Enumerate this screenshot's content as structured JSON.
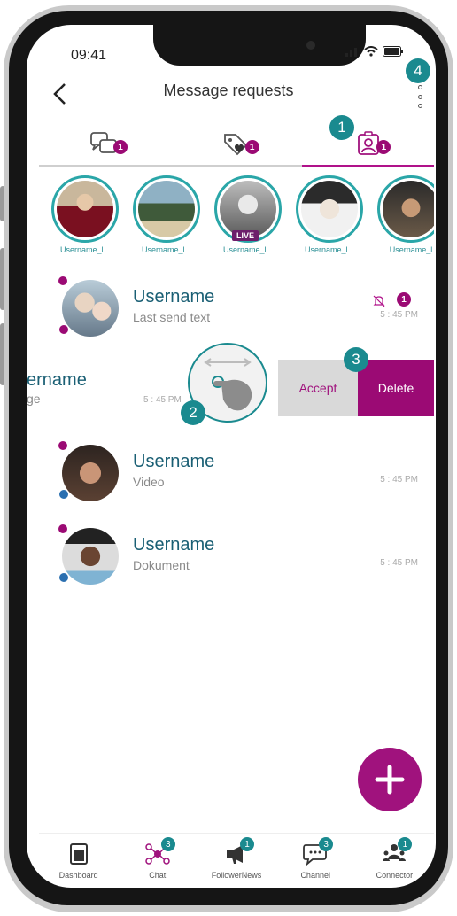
{
  "status_bar": {
    "time": "09:41"
  },
  "header": {
    "title": "Message requests"
  },
  "tabs": [
    {
      "name": "chats",
      "badge": "1"
    },
    {
      "name": "favorites",
      "badge": "1"
    },
    {
      "name": "contacts",
      "badge": "1"
    }
  ],
  "stories": [
    {
      "label": "Username_l..."
    },
    {
      "label": "Username_l..."
    },
    {
      "label": "Username_l...",
      "live": "LIVE"
    },
    {
      "label": "Username_l..."
    },
    {
      "label": "Username_l"
    }
  ],
  "messages": [
    {
      "username": "Username",
      "subtitle": "Last send text",
      "time": "5 : 45 PM",
      "badge": "1"
    },
    {
      "username": "ername",
      "subtitle": "ge",
      "time": "5 : 45 PM"
    },
    {
      "username": "Username",
      "subtitle": "Video",
      "time": "5 : 45 PM"
    },
    {
      "username": "Username",
      "subtitle": "Dokument",
      "time": "5 : 45 PM"
    }
  ],
  "swipe_actions": {
    "accept": "Accept",
    "delete": "Delete"
  },
  "markers": [
    "1",
    "2",
    "3",
    "4"
  ],
  "bottom_nav": [
    {
      "label": "Dashboard"
    },
    {
      "label": "Chat",
      "badge": "3"
    },
    {
      "label": "FollowerNews",
      "badge": "1"
    },
    {
      "label": "Channel",
      "badge": "3"
    },
    {
      "label": "Connector",
      "badge": "1"
    }
  ],
  "colors": {
    "brand": "#9b0a74",
    "accent_teal": "#1a8a8f",
    "text_name": "#1a5f74"
  }
}
